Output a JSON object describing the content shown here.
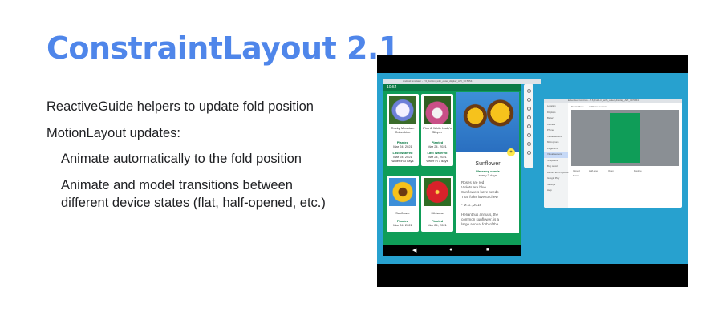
{
  "slide": {
    "title": "ConstraintLayout 2.1",
    "bullets": [
      "ReactiveGuide helpers to update fold position",
      "MotionLayout updates:",
      "Animate automatically to the fold position",
      "Animate and model transitions between",
      "different device states (flat, half-opened, etc.)"
    ]
  },
  "emulator": {
    "window_title": "Android Emulator - 7.6_Fold-in_with_outer_display_API_30:5554",
    "status_time": "10:54",
    "nav_icons": [
      "back-icon",
      "home-icon",
      "recents-icon"
    ],
    "plants": [
      {
        "name": "Rocky Mountain Columbine",
        "planted_label": "Planted",
        "planted": "Mar 24, 2021",
        "watered_label": "Last Watered",
        "watered": "Mar 24, 2021",
        "note": "water in 3 days"
      },
      {
        "name": "Pink & White Lady's Slipper",
        "planted_label": "Planted",
        "planted": "Mar 24, 2021",
        "watered_label": "Last Watered",
        "watered": "Mar 24, 2021",
        "note": "water in 7 days"
      },
      {
        "name": "Sunflower",
        "planted_label": "Planted",
        "planted": "Mar 24, 2021"
      },
      {
        "name": "Hibiscus",
        "planted_label": "Planted",
        "planted": "Mar 24, 2021"
      }
    ],
    "detail": {
      "title": "Sunflower",
      "watering_label": "Watering needs",
      "watering": "every 3 days",
      "poem": [
        "Roses are red",
        "Violets are blue",
        "Sunflowers have seeds",
        "That folks love to chew"
      ],
      "author": "- M.G., 2018",
      "description": [
        "Helianthus annuus, the",
        "common sunflower, is a",
        "large annual forb of the"
      ]
    }
  },
  "extended_controls": {
    "window_title": "Extended Controls - 7.6_Fold-in_with_outer_display_API_30:5554",
    "sidebar": [
      "Location",
      "Displays",
      "Battery",
      "Camera",
      "Phone",
      "Virtual sensors",
      "Microphone",
      "Fingerprint",
      "Virtual sensors",
      "Snapshots",
      "Bug report",
      "Record and Playback",
      "Google Play",
      "Settings",
      "Help"
    ],
    "selected_index": 8,
    "tabs": [
      "Device Pose",
      "Additional sensors"
    ],
    "posture_label": "Posture",
    "rotate_label": "Rotate",
    "postures": [
      "Closed",
      "Half-open",
      "Open"
    ]
  },
  "colors": {
    "title": "#4f86ea",
    "video_bg": "#27a1cf",
    "app_green": "#0f9d58"
  }
}
